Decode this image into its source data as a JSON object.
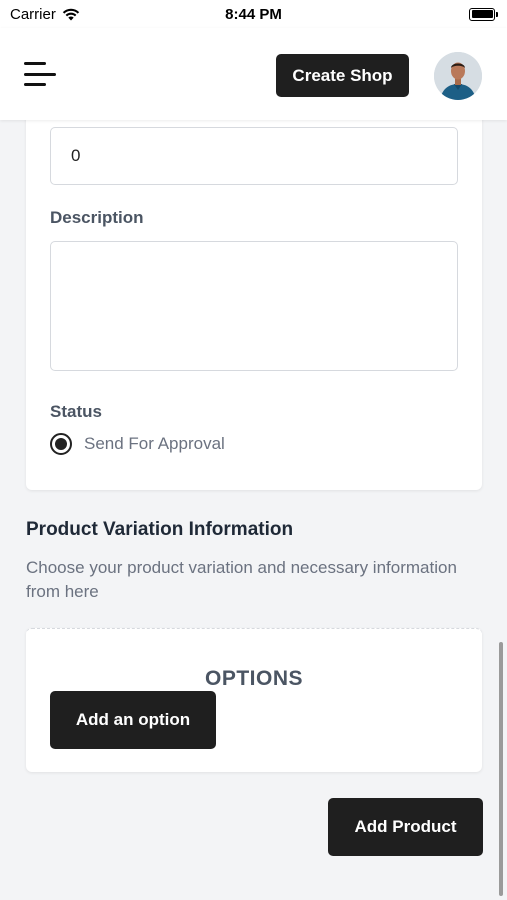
{
  "status_bar": {
    "carrier": "Carrier",
    "time": "8:44 PM",
    "icons": [
      "wifi-icon",
      "battery-icon"
    ]
  },
  "header": {
    "menu_icon": "hamburger-menu-icon",
    "create_shop_label": "Create Shop",
    "avatar_icon": "user-avatar"
  },
  "form": {
    "quantity_value": "0",
    "description_label": "Description",
    "description_value": "",
    "status_label": "Status",
    "status_option_label": "Send For Approval",
    "status_option_selected": true
  },
  "variation": {
    "title": "Product Variation Information",
    "subtitle": "Choose your product variation and necessary information from here",
    "options_title": "OPTIONS",
    "add_option_label": "Add an option"
  },
  "footer": {
    "add_product_label": "Add Product"
  },
  "colors": {
    "background": "#f3f4f6",
    "card": "#ffffff",
    "button": "#1f1f1f",
    "button_text": "#ffffff",
    "muted_text": "#6b7280"
  }
}
